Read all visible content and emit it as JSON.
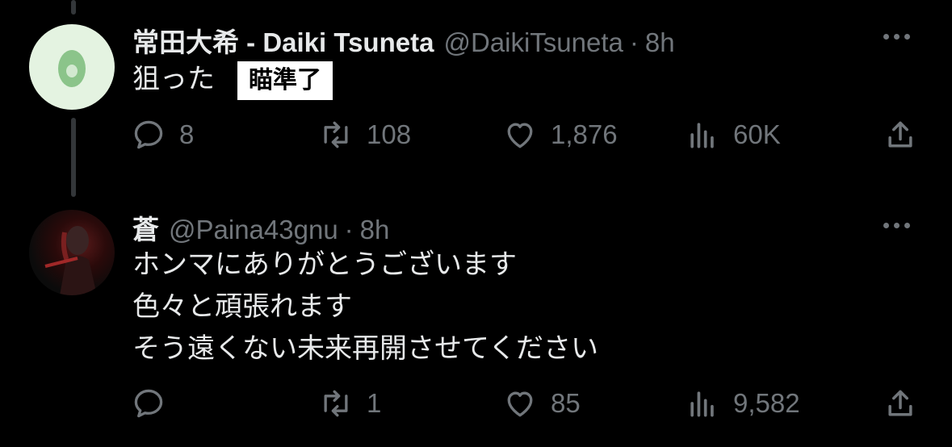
{
  "tweets": [
    {
      "name": "常田大希 - Daiki Tsuneta",
      "handle": "@DaikiTsuneta",
      "separator": "·",
      "time": "8h",
      "text_lines": [
        "狙った"
      ],
      "badge": "瞄準了",
      "avatar_icon": "egg-icon",
      "stats": {
        "replies": "8",
        "retweets": "108",
        "likes": "1,876",
        "views": "60K"
      }
    },
    {
      "name": "蒼",
      "handle": "@Paina43gnu",
      "separator": "·",
      "time": "8h",
      "text_lines": [
        "ホンマにありがとうございます",
        "色々と頑張れます",
        "そう遠くない未来再開させてください"
      ],
      "avatar_icon": "profile-photo",
      "stats": {
        "replies": "",
        "retweets": "1",
        "likes": "85",
        "views": "9,582"
      }
    }
  ],
  "colors": {
    "background": "#000000",
    "text": "#e7e9ea",
    "muted": "#71767b",
    "thread_line": "#333639",
    "egg_bg": "#e4f3e1",
    "egg_fg": "#8bc48a"
  }
}
